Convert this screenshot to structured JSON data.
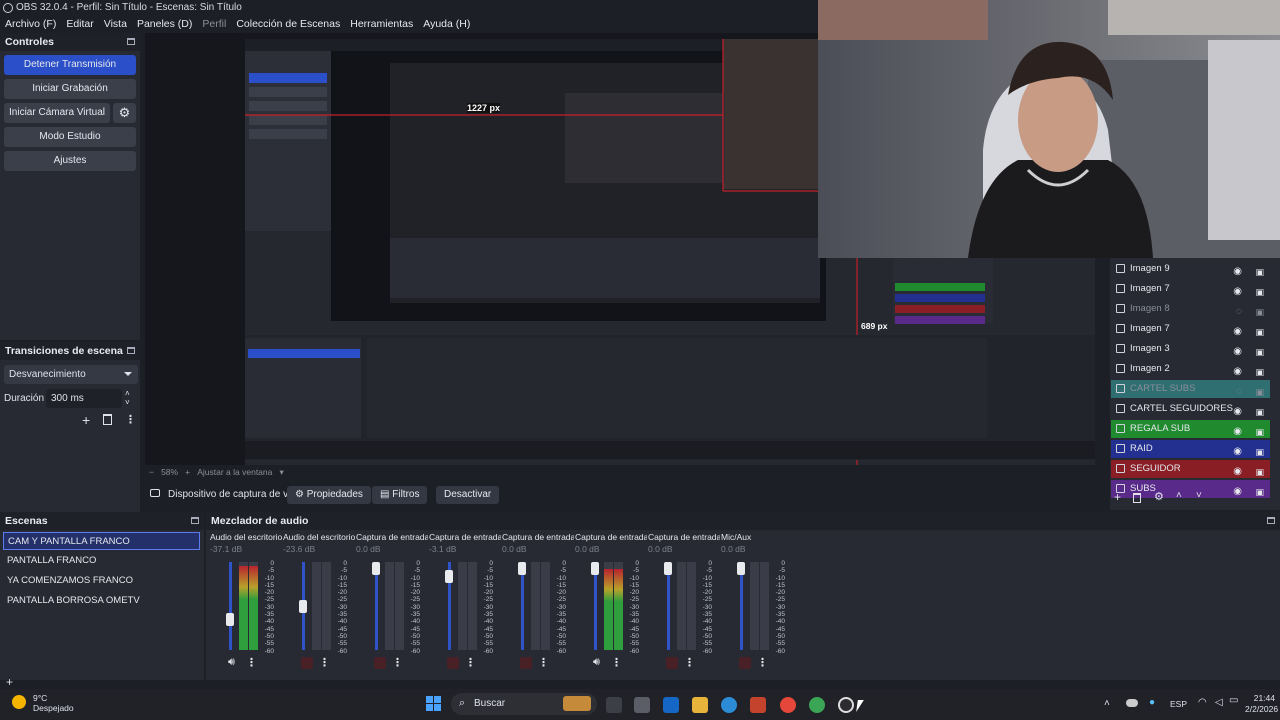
{
  "window": {
    "title": "OBS 32.0.4 - Perfil: Sin Título - Escenas: Sin Título"
  },
  "menu": [
    {
      "label": "Archivo (F)",
      "enabled": true
    },
    {
      "label": "Editar",
      "enabled": true
    },
    {
      "label": "Vista",
      "enabled": true
    },
    {
      "label": "Paneles (D)",
      "enabled": true
    },
    {
      "label": "Perfil",
      "enabled": false
    },
    {
      "label": "Colección de Escenas",
      "enabled": true
    },
    {
      "label": "Herramientas",
      "enabled": true
    },
    {
      "label": "Ayuda (H)",
      "enabled": true
    }
  ],
  "controls": {
    "title": "Controles",
    "stop_stream": "Detener Transmisión",
    "start_recording": "Iniciar Grabación",
    "start_virtual_cam": "Iniciar Cámara Virtual",
    "studio_mode": "Modo Estudio",
    "settings": "Ajustes"
  },
  "transitions": {
    "title": "Transiciones de escena",
    "selected": "Desvanecimiento",
    "duration_label": "Duración",
    "duration_value": "300 ms"
  },
  "preview": {
    "zoom": "58%",
    "fit_label": "Ajustar a la ventana",
    "measure_width": "1227 px",
    "measure_height": "689 px"
  },
  "source_toolbar": {
    "source_name": "Dispositivo de captura de v",
    "properties": "Propiedades",
    "filters": "Filtros",
    "deactivate": "Desactivar"
  },
  "scenes": {
    "title": "Escenas",
    "items": [
      {
        "label": "CAM Y PANTALLA FRANCO",
        "selected": true
      },
      {
        "label": "PANTALLA FRANCO",
        "selected": false
      },
      {
        "label": "YA COMENZAMOS FRANCO",
        "selected": false
      },
      {
        "label": "PANTALLA BORROSA OMETV",
        "selected": false
      }
    ]
  },
  "mixer": {
    "title": "Mezclador de audio",
    "scale": [
      "0",
      "-5",
      "-10",
      "-15",
      "-20",
      "-25",
      "-30",
      "-35",
      "-40",
      "-45",
      "-50",
      "-55",
      "-60"
    ],
    "channels": [
      {
        "name": "Audio del escritorio",
        "db": "-37.1 dB",
        "muted": false,
        "fader": 0.32,
        "level": 0.95
      },
      {
        "name": "Audio del escritorio",
        "db": "-23.6 dB",
        "muted": true,
        "fader": 0.5,
        "level": 0.0
      },
      {
        "name": "Captura de entrada",
        "db": "0.0 dB",
        "muted": true,
        "fader": 1.0,
        "level": 0.0
      },
      {
        "name": "Captura de entrada",
        "db": "-3.1 dB",
        "muted": true,
        "fader": 0.9,
        "level": 0.0
      },
      {
        "name": "Captura de entrada",
        "db": "0.0 dB",
        "muted": true,
        "fader": 1.0,
        "level": 0.0
      },
      {
        "name": "Captura de entrada",
        "db": "0.0 dB",
        "muted": false,
        "fader": 1.0,
        "level": 0.92
      },
      {
        "name": "Captura de entrada",
        "db": "0.0 dB",
        "muted": true,
        "fader": 1.0,
        "level": 0.0
      },
      {
        "name": "Mic/Aux",
        "db": "0.0 dB",
        "muted": true,
        "fader": 1.0,
        "level": 0.0
      }
    ]
  },
  "sources": {
    "items": [
      {
        "label": "Imagen 9",
        "visible": true,
        "color": ""
      },
      {
        "label": "Imagen 7",
        "visible": true,
        "color": ""
      },
      {
        "label": "Imagen 8",
        "visible": false,
        "color": ""
      },
      {
        "label": "Imagen 7",
        "visible": true,
        "color": ""
      },
      {
        "label": "Imagen 3",
        "visible": true,
        "color": ""
      },
      {
        "label": "Imagen 2",
        "visible": true,
        "color": ""
      },
      {
        "label": "CARTEL SUBS",
        "visible": false,
        "color": "#2f6f72"
      },
      {
        "label": "CARTEL SEGUIDORES",
        "visible": true,
        "color": ""
      },
      {
        "label": "REGALA SUB",
        "visible": true,
        "color": "#1f8a2e"
      },
      {
        "label": "RAID",
        "visible": true,
        "color": "#23308f"
      },
      {
        "label": "SEGUIDOR",
        "visible": true,
        "color": "#8a1e25"
      },
      {
        "label": "SUBS",
        "visible": true,
        "color": "#5a2a8a"
      }
    ]
  },
  "taskbar": {
    "weather_temp": "9°C",
    "weather_desc": "Despejado",
    "search": "Buscar",
    "lang": "ESP",
    "time": "21:44",
    "date": "2/2/2026"
  },
  "colors": {
    "accent": "#2a4fc8",
    "panel": "#272a33",
    "background": "#1d1f26"
  }
}
